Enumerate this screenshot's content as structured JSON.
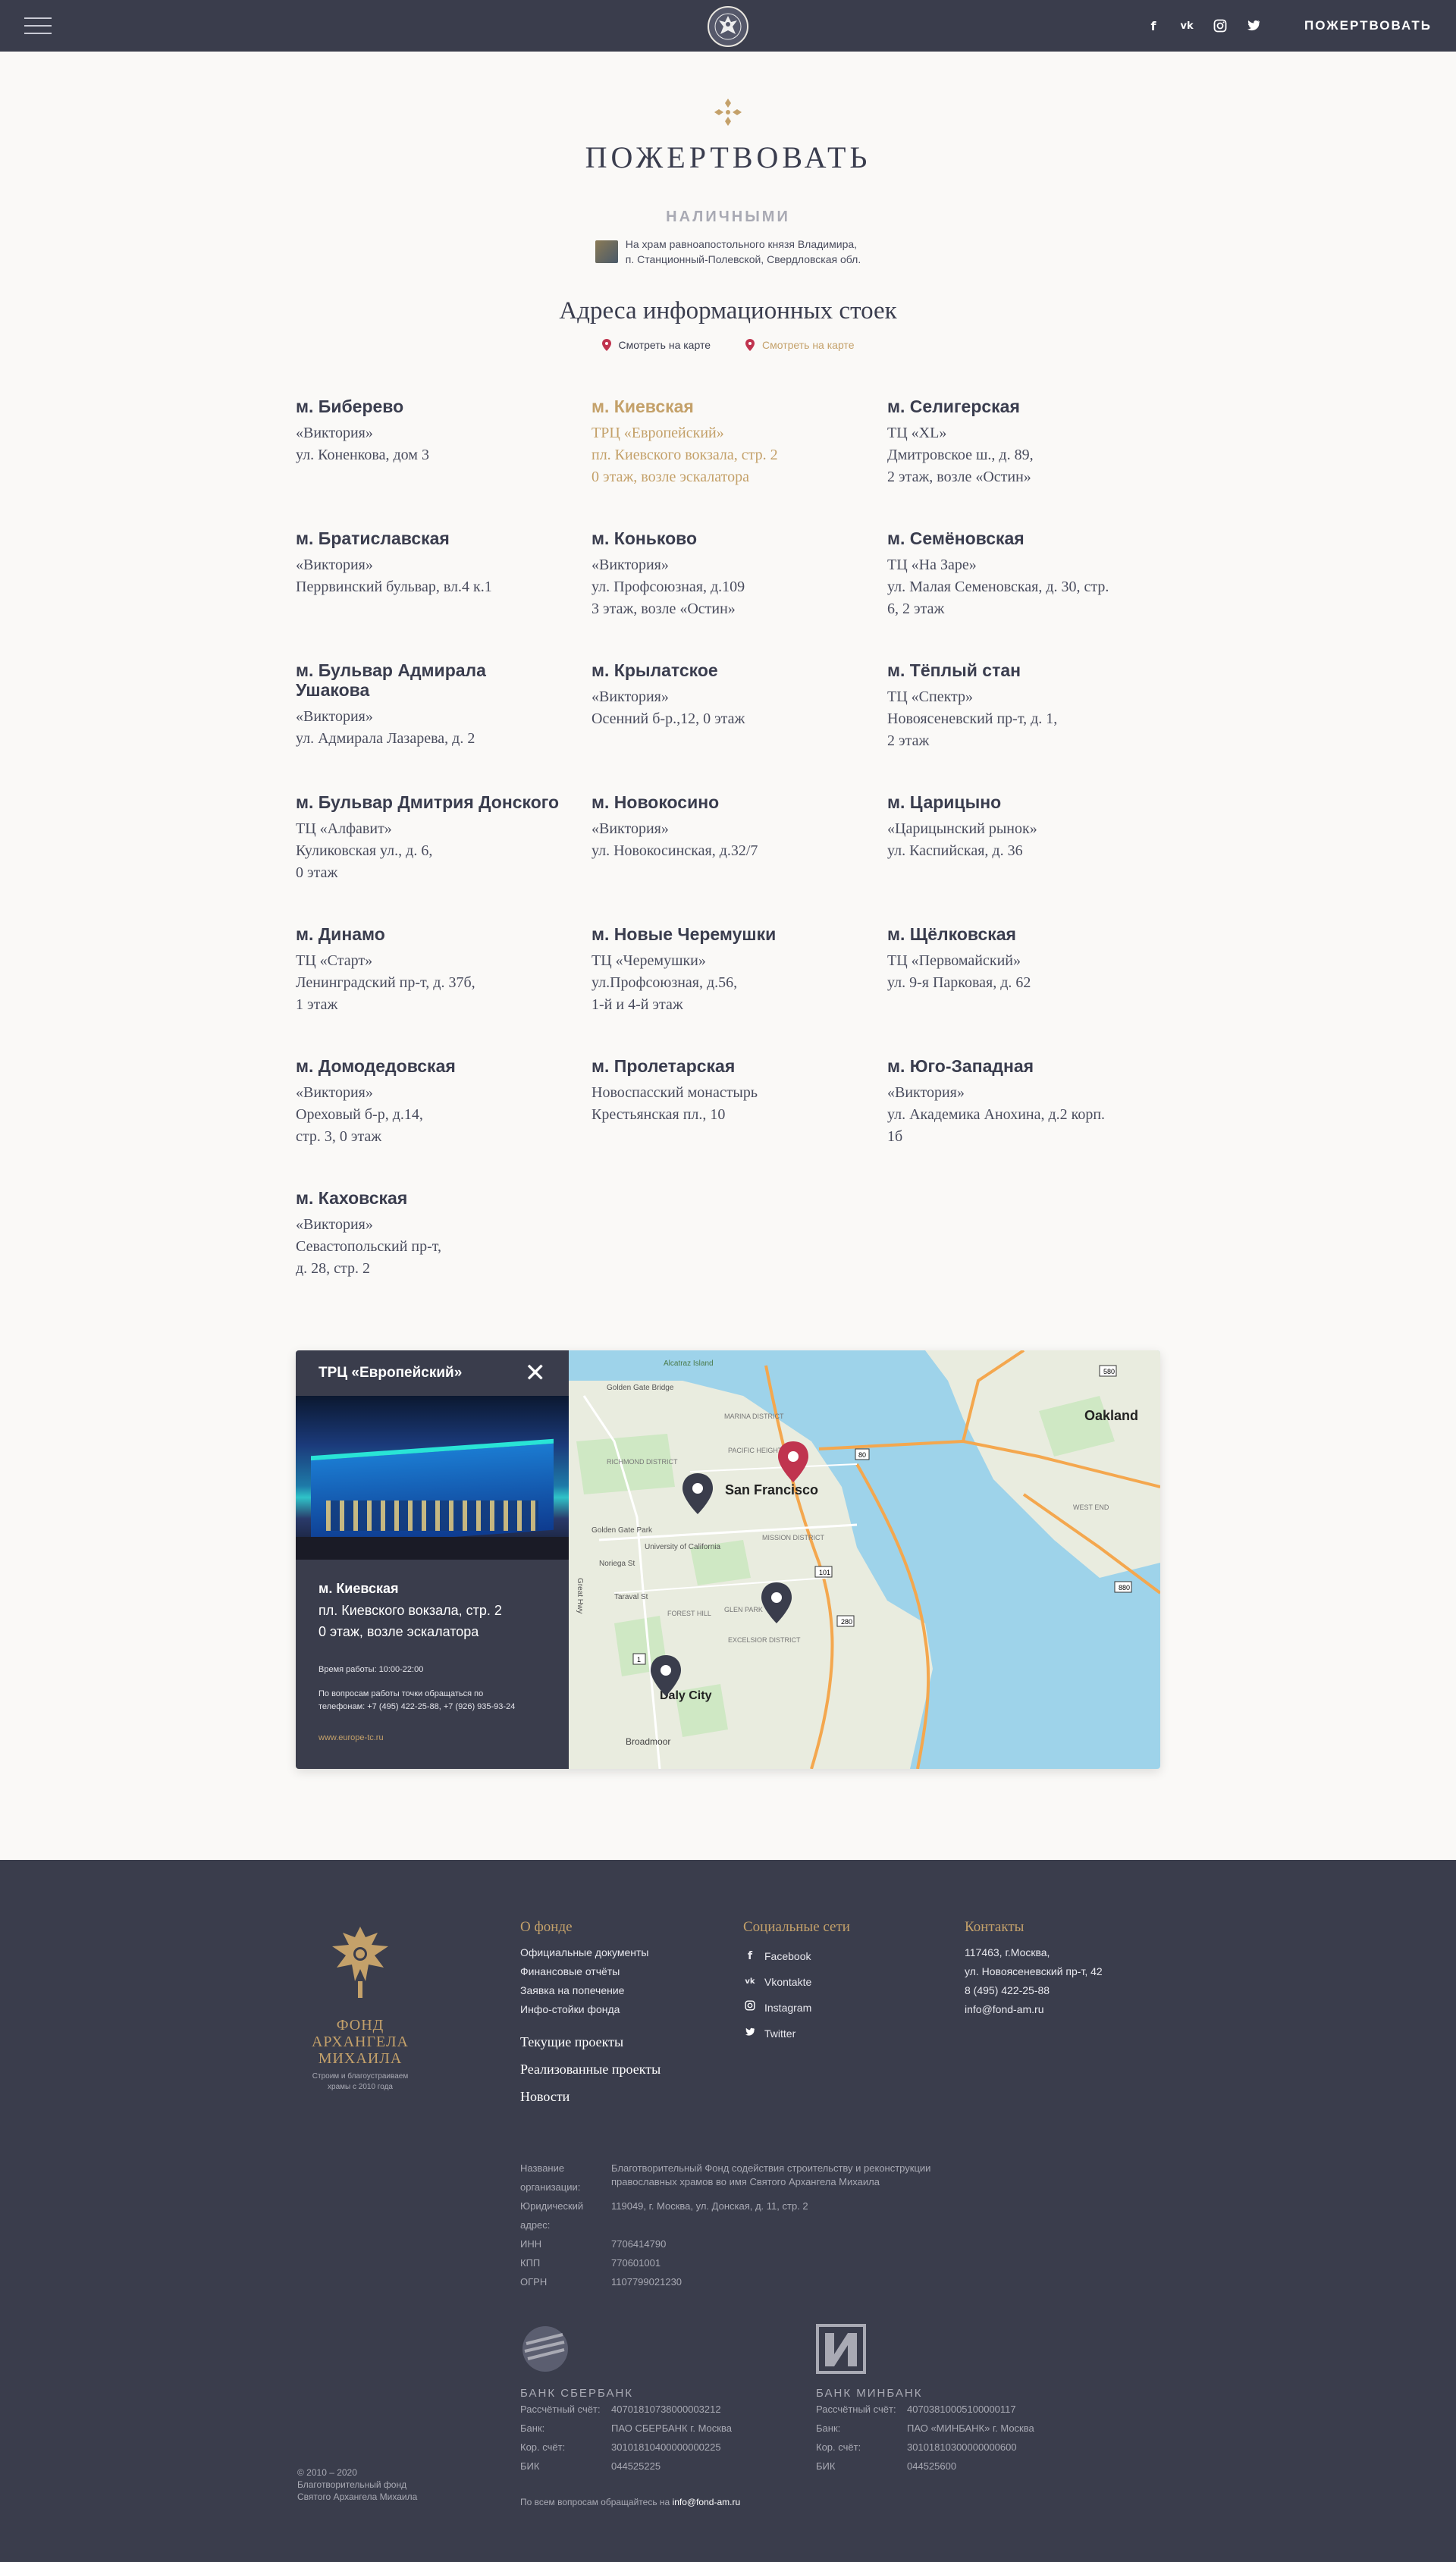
{
  "header": {
    "social": [
      "f",
      "vk",
      "ig",
      "tw"
    ],
    "donate_label": "ПОЖЕРТВОВАТЬ"
  },
  "page": {
    "title": "ПОЖЕРТВОВАТЬ",
    "subhead": "НАЛИЧНЫМИ",
    "church_text_1": "На храм равноапостольного князя Владимира,",
    "church_text_2": "п. Станционный-Полевской, Свердловская обл.",
    "addresses_title": "Адреса информационных стоек",
    "map_link_1": "Смотреть на карте",
    "map_link_2": "Смотреть на карте"
  },
  "stations": [
    {
      "station": "м. Биберево",
      "address": "«Виктория»\nул. Коненкова, дом 3"
    },
    {
      "station": "м. Киевская",
      "address": "ТРЦ «Европейский»\nпл. Киевского вокзала, стр. 2\n0 этаж, возле эскалатора"
    },
    {
      "station": "м. Селигерская",
      "address": "ТЦ «XL»\nДмитровское ш., д. 89,\n2 этаж, возле «Остин»"
    },
    {
      "station": "м. Братиславская",
      "address": "«Виктория»\nПеррвинский бульвар, вл.4 к.1"
    },
    {
      "station": "м. Коньково",
      "address": "«Виктория»\nул. Профсоюзная, д.109\n3 этаж, возле «Остин»"
    },
    {
      "station": "м. Семёновская",
      "address": "ТЦ «На Заре»\nул. Малая Семеновская, д. 30, стр.\n6,  2 этаж"
    },
    {
      "station": "м. Бульвар Адмирала\nУшакова",
      "address": "«Виктория»\nул. Адмирала Лазарева, д. 2"
    },
    {
      "station": "м. Крылатское",
      "address": "«Виктория»\nОсенний б-р.,12, 0 этаж"
    },
    {
      "station": "м. Тёплый стан",
      "address": "ТЦ «Спектр»\nНовоясеневский пр-т, д. 1,\n2 этаж"
    },
    {
      "station": "м. Бульвар Дмитрия Донского",
      "address": "ТЦ «Алфавит»\nКуликовская ул., д. 6,\n0 этаж"
    },
    {
      "station": "м. Новокосино",
      "address": "«Виктория»\nул. Новокосинская, д.32/7"
    },
    {
      "station": "м. Царицыно",
      "address": "«Царицынский рынок»\nул. Каспийская, д. 36"
    },
    {
      "station": "м. Динамо",
      "address": "ТЦ «Старт»\nЛенинградский пр-т, д. 37б,\n1 этаж"
    },
    {
      "station": "м. Новые Черемушки",
      "address": "ТЦ «Черемушки»\nул.Профсоюзная, д.56,\n1-й и 4-й этаж"
    },
    {
      "station": "м. Щёлковская",
      "address": "ТЦ «Первомайский»\nул. 9-я Парковая, д. 62"
    },
    {
      "station": "м. Домодедовская",
      "address": "«Виктория»\nОреховый б-р, д.14,\nстр. 3, 0 этаж"
    },
    {
      "station": "м. Пролетарская",
      "address": "Новоспасский монастырь\nКрестьянская пл., 10"
    },
    {
      "station": "м. Юго-Западная",
      "address": "«Виктория»\nул. Академика Анохина, д.2 корп.\n1б"
    },
    {
      "station": "м. Каховская",
      "address": "«Виктория»\nСевастопольский пр-т,\nд. 28, стр. 2"
    }
  ],
  "popup": {
    "title": "ТРЦ «Европейский»",
    "station": "м. Киевская",
    "address": "пл. Киевского вокзала, стр. 2\n0 этаж, возле эскалатора",
    "hours": "Время работы: 10:00-22:00",
    "phones": "По вопросам работы точки обращаться по\nтелефонам: +7 (495) 422-25-88, +7 (926) 935-93-24",
    "site": "www.europe-tc.ru"
  },
  "map": {
    "labels": [
      "San Francisco",
      "Oakland",
      "Daly City",
      "Alcatraz Island",
      "Golden Gate Bridge",
      "Golden Gate Park",
      "University of California",
      "RICHMOND DISTRICT",
      "MARINA DISTRICT",
      "PACIFIC HEIGHTS",
      "MISSION DISTRICT",
      "GLEN PARK",
      "EXCELSIOR DISTRICT",
      "WEST END",
      "Broadmoor",
      "Taraval St",
      "Noriega St",
      "Great Hwy",
      "FOREST HILL"
    ],
    "road_numbers": [
      "101",
      "280",
      "1",
      "880",
      "580",
      "80"
    ]
  },
  "footer": {
    "org_name": "ФОНД\nАРХАНГЕЛА\nМИХАИЛА",
    "tagline": "Строим и благоустраиваем\nхрамы с 2010 года",
    "about_title": "О фонде",
    "about_links": [
      "Официальные документы",
      "Финансовые отчёты",
      "Заявка на попечение",
      "Инфо-стойки фонда"
    ],
    "big_links": [
      "Текущие проекты",
      "Реализованные проекты",
      "Новости"
    ],
    "social_title": "Социальные сети",
    "social_links": [
      "Facebook",
      "Vkontakte",
      "Instagram",
      "Twitter"
    ],
    "contacts_title": "Контакты",
    "contacts": [
      "117463, г.Москва,",
      "ул. Новоясеневский пр-т, 42",
      "8 (495) 422-25-88",
      "info@fond-am.ru"
    ],
    "legal": [
      {
        "k": "Название организации:",
        "v": "Благотворительный Фонд содействия строительству и реконструкции\nправославных храмов во имя Святого Архангела Михаила"
      },
      {
        "k": "Юридический адрес:",
        "v": "119049, г. Москва, ул. Донская, д. 11, стр. 2"
      },
      {
        "k": "ИНН",
        "v": "7706414790"
      },
      {
        "k": "КПП",
        "v": "770601001"
      },
      {
        "k": "ОГРН",
        "v": "1107799021230"
      }
    ],
    "bank1": {
      "name": "БАНК СБЕРБАНК",
      "rows": [
        {
          "k": "Рассчётный счёт:",
          "v": "40701810738000003212"
        },
        {
          "k": "Банк:",
          "v": "ПАО СБЕРБАНК г. Москва"
        },
        {
          "k": "Кор. счёт:",
          "v": "30101810400000000225"
        },
        {
          "k": "БИК",
          "v": "044525225"
        }
      ]
    },
    "bank2": {
      "name": "БАНК МИНБАНК",
      "rows": [
        {
          "k": "Рассчётный счёт:",
          "v": "40703810005100000117"
        },
        {
          "k": "Банк:",
          "v": "ПАО «МИНБАНК» г. Москва"
        },
        {
          "k": "Кор. счёт:",
          "v": "30101810300000000600"
        },
        {
          "k": "БИК",
          "v": "044525600"
        }
      ]
    },
    "copyright": "© 2010 – 2020\nБлаготворительный фонд\nСвятого Архангела Михаила",
    "contact_prefix": "По всем вопросам обращайтесь на ",
    "contact_email": "info@fond-am.ru"
  },
  "colors": {
    "accent": "#c4a16a",
    "dark": "#3a3d4c",
    "pin_red": "#c0344f"
  }
}
